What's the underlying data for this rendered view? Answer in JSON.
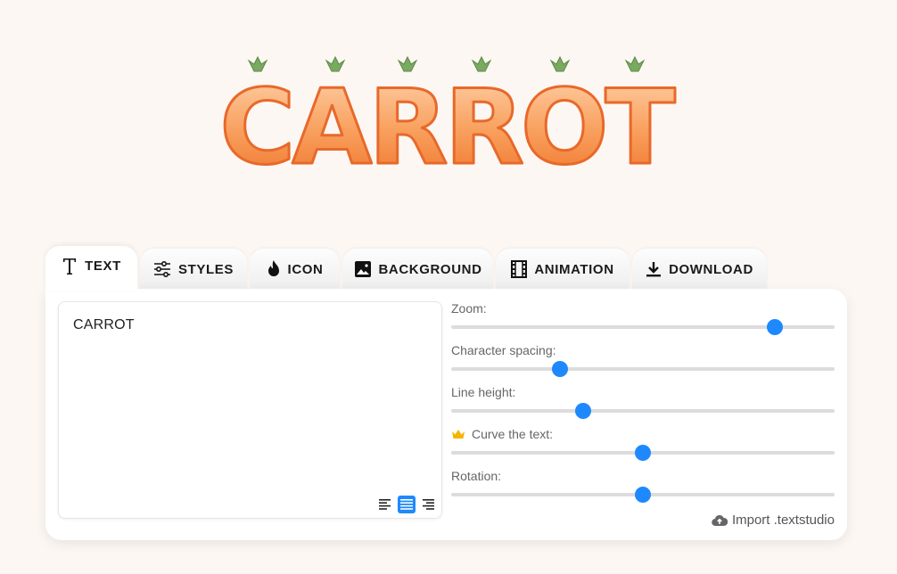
{
  "preview": {
    "text": "CARROT"
  },
  "colors": {
    "accent": "#1e88ff",
    "carrot": "#f6883a",
    "leaf": "#6ba05a",
    "background": "#fdf7f3"
  },
  "tabs": [
    {
      "label": "TEXT",
      "icon": "text-icon",
      "active": true
    },
    {
      "label": "STYLES",
      "icon": "sliders-icon",
      "active": false
    },
    {
      "label": "ICON",
      "icon": "flame-icon",
      "active": false
    },
    {
      "label": "BACKGROUND",
      "icon": "image-icon",
      "active": false
    },
    {
      "label": "ANIMATION",
      "icon": "film-icon",
      "active": false
    },
    {
      "label": "DOWNLOAD",
      "icon": "download-icon",
      "active": false
    }
  ],
  "editor": {
    "text": "CARROT",
    "alignment": "center",
    "align_buttons": [
      "align-left-icon",
      "align-center-icon",
      "align-right-icon"
    ]
  },
  "sliders": [
    {
      "label": "Zoom:",
      "value": 0.844
    },
    {
      "label": "Character spacing:",
      "value": 0.284
    },
    {
      "label": "Line height:",
      "value": 0.345
    },
    {
      "label": "Curve the text:",
      "value": 0.5,
      "premium_icon": "crown-icon"
    },
    {
      "label": "Rotation:",
      "value": 0.5
    }
  ],
  "import": {
    "label": "Import .textstudio",
    "icon": "cloud-upload-icon"
  }
}
